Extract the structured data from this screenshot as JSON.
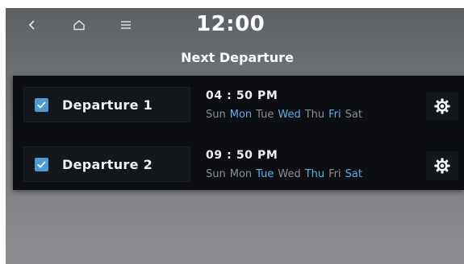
{
  "status_bar": {
    "back_icon": "back-arrow-icon",
    "home_icon": "home-icon",
    "menu_icon": "menu-icon",
    "clock": "12:00"
  },
  "page": {
    "title": "Next Departure"
  },
  "departures": [
    {
      "label": "Departure 1",
      "checked": true,
      "time": "04 : 50 PM",
      "days": [
        {
          "name": "Sun",
          "active": false
        },
        {
          "name": "Mon",
          "active": true
        },
        {
          "name": "Tue",
          "active": false
        },
        {
          "name": "Wed",
          "active": true
        },
        {
          "name": "Thu",
          "active": false
        },
        {
          "name": "Fri",
          "active": true
        },
        {
          "name": "Sat",
          "active": false
        }
      ],
      "settings_icon": "gear-icon"
    },
    {
      "label": "Departure 2",
      "checked": true,
      "time": "09 : 50 PM",
      "days": [
        {
          "name": "Sun",
          "active": false
        },
        {
          "name": "Mon",
          "active": false
        },
        {
          "name": "Tue",
          "active": true
        },
        {
          "name": "Wed",
          "active": false
        },
        {
          "name": "Thu",
          "active": true
        },
        {
          "name": "Fri",
          "active": false
        },
        {
          "name": "Sat",
          "active": true
        }
      ],
      "settings_icon": "gear-icon"
    }
  ],
  "colors": {
    "accent": "#55b3e8",
    "checkbox": "#4d9ad6",
    "inactive_day": "#8b8e93",
    "panel": "#0c0e11"
  }
}
